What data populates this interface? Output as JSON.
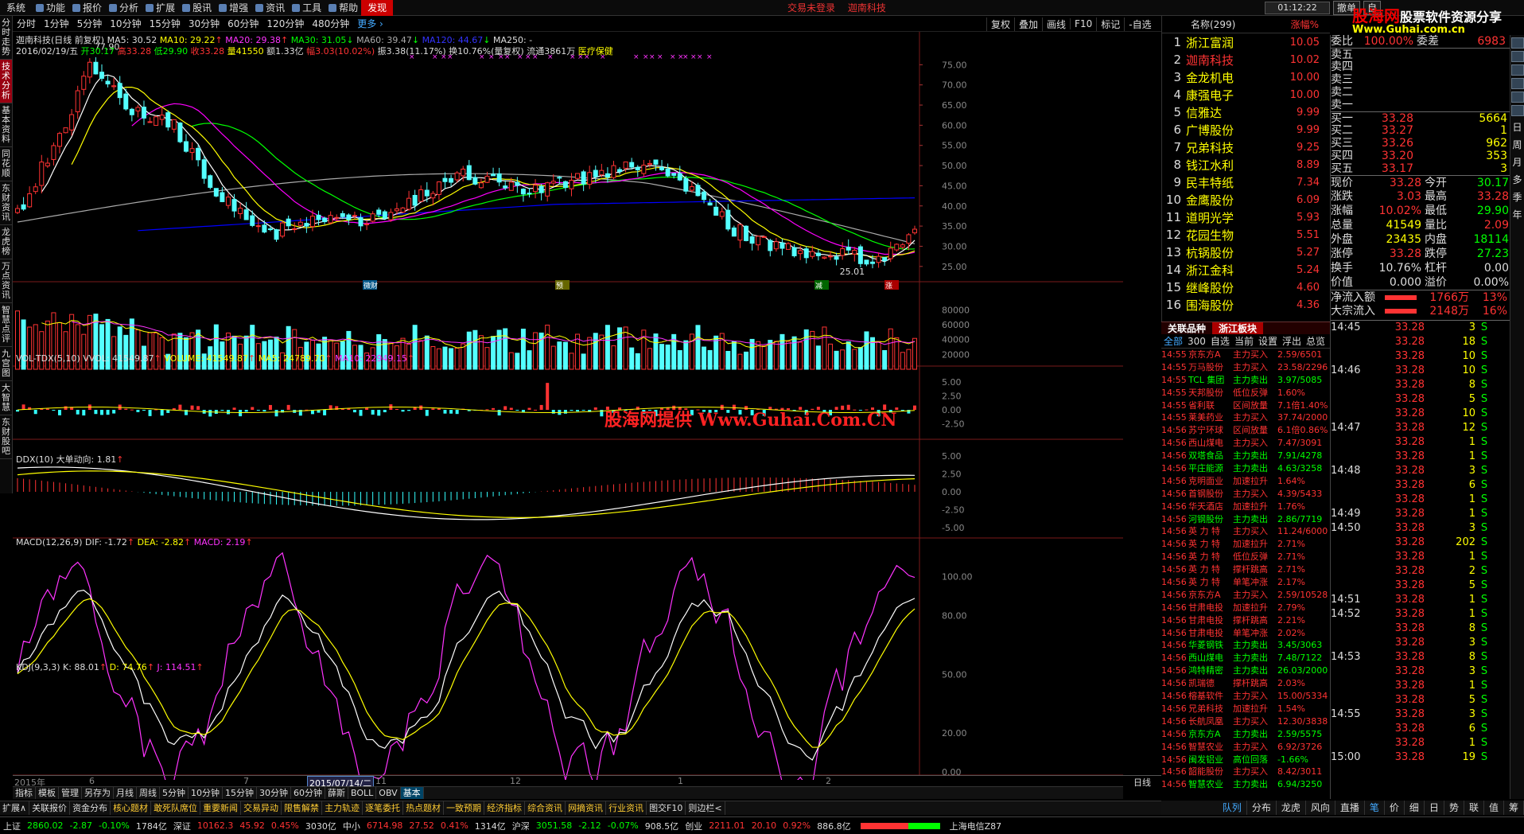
{
  "menu": {
    "items": [
      "系统",
      "功能",
      "报价",
      "分析",
      "扩展",
      "股讯",
      "增强",
      "资讯",
      "工具",
      "帮助"
    ],
    "icon_items": [
      1,
      2,
      3,
      4,
      5,
      6,
      7,
      8,
      9
    ],
    "discover": "发现",
    "login_status": "交易未登录",
    "stock_name_top": "迦南科技",
    "clock": "01:12:22",
    "btn_sell": "撤单",
    "btn_self": "自"
  },
  "logo": {
    "title_red": "股海网",
    "title_white": "股票软件资源分享",
    "url": "Www.Guhai.com.cn"
  },
  "left_tabs": [
    "分时走势",
    "技术分析",
    "基本资料",
    "同花顺",
    "东财资讯",
    "龙虎榜",
    "万点资讯",
    "智慧点评",
    "九宫图",
    "大智慧",
    "东财股吧"
  ],
  "period_tabs": [
    "分时",
    "1分钟",
    "5分钟",
    "10分钟",
    "15分钟",
    "30分钟",
    "60分钟",
    "120分钟",
    "480分钟"
  ],
  "period_more": "更多 ›",
  "right_tools": [
    "复权",
    "叠加",
    "画线",
    "F10",
    "标记",
    "-自选"
  ],
  "main_chart": {
    "title": "迦南科技(日线 前复权)",
    "ma5": "MA5: 30.52",
    "ma10": "MA10: 29.22",
    "ma20": "MA20: 29.38",
    "ma30": "MA30: 31.05",
    "ma60": "MA60: 39.47",
    "ma120": "MA120: 44.67",
    "ma250": "MA250: -",
    "info_date": "2016/02/19/五",
    "info_open": "开30.17",
    "info_high": "高33.28",
    "info_low": "低29.90",
    "info_close": "收33.28",
    "info_vol": "量41550",
    "info_amt": "额1.33亿",
    "info_chg": "幅3.03(10.02%)",
    "info_amp": "振3.38(11.17%)",
    "info_turn": "换10.76%(量复权)",
    "info_float": "流通3861万",
    "info_sector": "医疗保健",
    "high_label": "77.90",
    "low_label": "25.01",
    "yaxis": [
      "75.00",
      "70.00",
      "65.00",
      "60.00",
      "55.00",
      "50.00",
      "45.00",
      "40.00",
      "35.00",
      "30.00",
      "25.00"
    ],
    "markers": [
      "微财",
      "预",
      "减",
      "涨"
    ]
  },
  "vol_panel": {
    "title": "VOL-TDX(5,10)",
    "vol": "VVOL: 41549.87",
    "volume": "VOLUME: 41549.87",
    "ma5": "MA5: 24789.70",
    "ma10": "MA10: 22949.15",
    "yaxis": [
      "80000",
      "60000",
      "40000",
      "20000"
    ]
  },
  "ddx_panel": {
    "title": "DDX(10)",
    "label": "大单动向: 1.81",
    "yaxis": [
      "5.00",
      "2.50",
      "0.00",
      "-2.50"
    ]
  },
  "macd_panel": {
    "title": "MACD(12,26,9)",
    "dif": "DIF: -1.72",
    "dea": "DEA: -2.82",
    "macd": "MACD: 2.19",
    "yaxis": [
      "5.00",
      "2.50",
      "0.00",
      "-2.50",
      "-5.00"
    ]
  },
  "kdj_panel": {
    "title": "KDJ(9,3,3)",
    "k": "K: 88.01",
    "d": "D: 74.76",
    "j": "J: 114.51",
    "yaxis": [
      "100.00",
      "80.00",
      "50.00",
      "20.00",
      "0.00"
    ]
  },
  "watermark": "股海网提供 Www.Guhai.Com.CN",
  "xaxis": {
    "labels": [
      "2015年",
      "6",
      "7",
      "2015/07/14/二",
      "11",
      "12",
      "1",
      "2"
    ],
    "period": "日线"
  },
  "chart_tabs": [
    "指标",
    "模板",
    "管理",
    "另存为",
    "月线",
    "周线",
    "5分钟",
    "10分钟",
    "15分钟",
    "30分钟",
    "60分钟",
    "薛斯",
    "BOLL",
    "OBV",
    "基本"
  ],
  "news_tabs": [
    "扩展∧",
    "关联报价",
    "资金分布",
    "核心题材",
    "敢死队席位",
    "重要新闻",
    "交易异动",
    "限售解禁",
    "主力轨迹",
    "逐笔委托",
    "热点题材",
    "一致预期",
    "经济指标",
    "综合资讯",
    "网摘资讯",
    "行业资讯",
    "图交F10",
    "则边栏<"
  ],
  "index_bar": {
    "sh_name": "上证",
    "sh": "2860.02",
    "sh_chg": "-2.87",
    "sh_pct": "-0.10%",
    "sh_amt": "1784亿",
    "sz_name": "深证",
    "sz": "10162.3",
    "sz_chg": "45.92",
    "sz_pct": "0.45%",
    "sz_amt": "3030亿",
    "zx_name": "中小",
    "zx": "6714.98",
    "zx_chg": "27.52",
    "zx_pct": "0.41%",
    "zx_amt": "1314亿",
    "hs_name": "沪深",
    "hs": "3051.58",
    "hs_chg": "-2.12",
    "hs_pct": "-0.07%",
    "hs_amt": "908.5亿",
    "cy_name": "创业",
    "cy": "2211.01",
    "cy_chg": "20.10",
    "cy_pct": "0.92%",
    "cy_amt": "886.8亿",
    "net": "上海电信Z87"
  },
  "rank": {
    "title": "名称(299)",
    "col": "涨幅%",
    "rows": [
      [
        "1",
        "浙江富润",
        "10.05"
      ],
      [
        "2",
        "迦南科技",
        "10.02"
      ],
      [
        "3",
        "金龙机电",
        "10.00"
      ],
      [
        "4",
        "康强电子",
        "10.00"
      ],
      [
        "5",
        "信雅达",
        "9.99"
      ],
      [
        "6",
        "广博股份",
        "9.99"
      ],
      [
        "7",
        "兄弟科技",
        "9.25"
      ],
      [
        "8",
        "钱江水利",
        "8.89"
      ],
      [
        "9",
        "民丰特纸",
        "7.34"
      ],
      [
        "10",
        "金鹰股份",
        "6.09"
      ],
      [
        "11",
        "道明光学",
        "5.93"
      ],
      [
        "12",
        "花园生物",
        "5.51"
      ],
      [
        "13",
        "杭锅股份",
        "5.27"
      ],
      [
        "14",
        "浙江金科",
        "5.24"
      ],
      [
        "15",
        "继峰股份",
        "4.60"
      ],
      [
        "16",
        "围海股份",
        "4.36"
      ]
    ],
    "tabs": [
      "关联品种",
      "浙江板块"
    ],
    "filter_tabs": [
      "全部",
      "300",
      "自选",
      "当前",
      "设置",
      "浮出",
      "总览"
    ]
  },
  "ticker": [
    [
      "14:55",
      "京东方A",
      "主力买入",
      "2.59/6501"
    ],
    [
      "14:55",
      "万马股份",
      "主力买入",
      "23.58/2296"
    ],
    [
      "14:55",
      "TCL 集团",
      "主力卖出",
      "3.97/5085"
    ],
    [
      "14:55",
      "天邦股份",
      "低位反弹",
      "1.60%"
    ],
    [
      "14:55",
      "省利联",
      "区间放量",
      "7.1倍1.40%"
    ],
    [
      "14:55",
      "莱美药业",
      "主力买入",
      "37.74/2000"
    ],
    [
      "14:56",
      "苏宁环球",
      "区间放量",
      "6.1倍0.86%"
    ],
    [
      "14:56",
      "西山煤电",
      "主力买入",
      "7.47/3091"
    ],
    [
      "14:56",
      "双塔食品",
      "主力卖出",
      "7.91/4278"
    ],
    [
      "14:56",
      "平庄能源",
      "主力卖出",
      "4.63/3258"
    ],
    [
      "14:56",
      "克明面业",
      "加速拉升",
      "1.64%"
    ],
    [
      "14:56",
      "首钢股份",
      "主力买入",
      "4.39/5433"
    ],
    [
      "14:56",
      "华天酒店",
      "加速拉升",
      "1.76%"
    ],
    [
      "14:56",
      "河钢股份",
      "主力卖出",
      "2.86/7719"
    ],
    [
      "14:56",
      "英 力 特",
      "主力买入",
      "11.24/6000"
    ],
    [
      "14:56",
      "英 力 特",
      "加速拉升",
      "2.71%"
    ],
    [
      "14:56",
      "英 力 特",
      "低位反弹",
      "2.71%"
    ],
    [
      "14:56",
      "英 力 特",
      "撑杆跳高",
      "2.71%"
    ],
    [
      "14:56",
      "英 力 特",
      "单笔冲涨",
      "2.17%"
    ],
    [
      "14:56",
      "京东方A",
      "主力买入",
      "2.59/10528"
    ],
    [
      "14:56",
      "甘肃电投",
      "加速拉升",
      "2.79%"
    ],
    [
      "14:56",
      "甘肃电投",
      "撑杆跳高",
      "2.21%"
    ],
    [
      "14:56",
      "甘肃电投",
      "单笔冲涨",
      "2.02%"
    ],
    [
      "14:56",
      "华菱钢铁",
      "主力卖出",
      "3.45/3063"
    ],
    [
      "14:56",
      "西山煤电",
      "主力卖出",
      "7.48/7122"
    ],
    [
      "14:56",
      "鸿特精密",
      "主力卖出",
      "26.03/2000"
    ],
    [
      "14:56",
      "凯瑞德",
      "撑杆跳高",
      "2.03%"
    ],
    [
      "14:56",
      "榕基软件",
      "主力买入",
      "15.00/5334"
    ],
    [
      "14:56",
      "兄弟科技",
      "加速拉升",
      "1.54%"
    ],
    [
      "14:56",
      "长航凤凰",
      "主力买入",
      "12.30/3838"
    ],
    [
      "14:56",
      "京东方A",
      "主力卖出",
      "2.59/5575"
    ],
    [
      "14:56",
      "智慧农业",
      "主力买入",
      "6.92/3726"
    ],
    [
      "14:56",
      "闽发铝业",
      "高位回落",
      "-1.66%"
    ],
    [
      "14:56",
      "韶能股份",
      "主力买入",
      "8.42/3011"
    ],
    [
      "14:56",
      "智慧农业",
      "主力卖出",
      "6.94/3250"
    ]
  ],
  "quote": {
    "wei_label": "委比",
    "wei_val": "100.00%",
    "wei_diff_label": "委差",
    "wei_diff": "6983",
    "sell": [
      [
        "卖五",
        "",
        ""
      ],
      [
        "卖四",
        "",
        ""
      ],
      [
        "卖三",
        "",
        ""
      ],
      [
        "卖二",
        "",
        ""
      ],
      [
        "卖一",
        "",
        ""
      ]
    ],
    "buy": [
      [
        "买一",
        "33.28",
        "5664"
      ],
      [
        "买二",
        "33.27",
        "1"
      ],
      [
        "买三",
        "33.26",
        "962"
      ],
      [
        "买四",
        "33.20",
        "353"
      ],
      [
        "买五",
        "33.17",
        "3"
      ]
    ],
    "stats": [
      [
        "现价",
        "33.28",
        "今开",
        "30.17"
      ],
      [
        "涨跌",
        "3.03",
        "最高",
        "33.28"
      ],
      [
        "涨幅",
        "10.02%",
        "最低",
        "29.90"
      ],
      [
        "总量",
        "41549",
        "量比",
        "2.09"
      ],
      [
        "外盘",
        "23435",
        "内盘",
        "18114"
      ],
      [
        "涨停",
        "33.28",
        "跌停",
        "27.23"
      ],
      [
        "换手",
        "10.76%",
        "杠杆",
        "0.00"
      ],
      [
        "价值",
        "0.000",
        "溢价",
        "0.00%"
      ]
    ],
    "flow": [
      [
        "净流入额",
        "1766万",
        "13%"
      ],
      [
        "大宗流入",
        "2148万",
        "16%"
      ]
    ],
    "trades": [
      [
        "14:45",
        "33.28",
        "3",
        "S"
      ],
      [
        "",
        "33.28",
        "18",
        "S"
      ],
      [
        "",
        "33.28",
        "10",
        "S"
      ],
      [
        "14:46",
        "33.28",
        "10",
        "S"
      ],
      [
        "",
        "33.28",
        "8",
        "S"
      ],
      [
        "",
        "33.28",
        "5",
        "S"
      ],
      [
        "",
        "33.28",
        "10",
        "S"
      ],
      [
        "14:47",
        "33.28",
        "12",
        "S"
      ],
      [
        "",
        "33.28",
        "1",
        "S"
      ],
      [
        "",
        "33.28",
        "1",
        "S"
      ],
      [
        "14:48",
        "33.28",
        "3",
        "S"
      ],
      [
        "",
        "33.28",
        "6",
        "S"
      ],
      [
        "",
        "33.28",
        "1",
        "S"
      ],
      [
        "14:49",
        "33.28",
        "1",
        "S"
      ],
      [
        "14:50",
        "33.28",
        "3",
        "S"
      ],
      [
        "",
        "33.28",
        "202",
        "S"
      ],
      [
        "",
        "33.28",
        "1",
        "S"
      ],
      [
        "",
        "33.28",
        "2",
        "S"
      ],
      [
        "",
        "33.28",
        "5",
        "S"
      ],
      [
        "14:51",
        "33.28",
        "1",
        "S"
      ],
      [
        "14:52",
        "33.28",
        "1",
        "S"
      ],
      [
        "",
        "33.28",
        "8",
        "S"
      ],
      [
        "",
        "33.28",
        "3",
        "S"
      ],
      [
        "14:53",
        "33.28",
        "8",
        "S"
      ],
      [
        "",
        "33.28",
        "3",
        "S"
      ],
      [
        "",
        "33.28",
        "1",
        "S"
      ],
      [
        "",
        "33.28",
        "5",
        "S"
      ],
      [
        "14:55",
        "33.28",
        "3",
        "S"
      ],
      [
        "",
        "33.28",
        "6",
        "S"
      ],
      [
        "",
        "33.28",
        "1",
        "S"
      ],
      [
        "15:00",
        "33.28",
        "19",
        "S"
      ]
    ]
  },
  "side_tools_text": [
    "日",
    "周",
    "月",
    "多",
    "季",
    "年"
  ],
  "quote_tabs": [
    "队列",
    "分布",
    "龙虎",
    "风向",
    "直播",
    "笔",
    "价",
    "细",
    "日",
    "势",
    "联",
    "值",
    "筹"
  ],
  "colors": {
    "up": "#ff3333",
    "down": "#00ff00",
    "ma5": "#ffffff",
    "ma10": "#ffff00",
    "ma20": "#ff00ff",
    "ma30": "#00ff00",
    "ma60": "#aaaaaa",
    "ma120": "#0000ff",
    "candle_down": "#54ffff"
  }
}
